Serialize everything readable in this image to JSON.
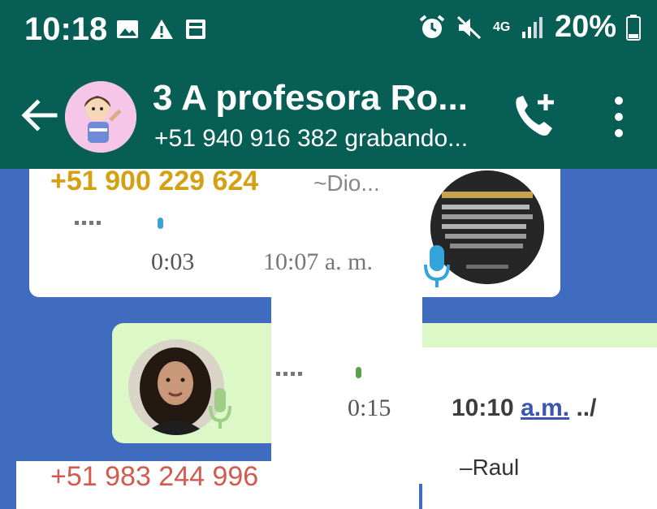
{
  "status_bar": {
    "time": "10:18",
    "network": "4G",
    "battery_percent": "20%"
  },
  "header": {
    "title": "3 A  profesora  Ro...",
    "subtitle": "+51 940 916 382 grabando..."
  },
  "messages": [
    {
      "sender": "+51 900 229 624",
      "alias": "~Dio...",
      "type": "voice",
      "duration": "0:03",
      "time": "10:07 a. m."
    },
    {
      "type": "voice",
      "duration": "0:15",
      "time_prefix": "10:10",
      "time_ampm": "a.m.",
      "time_suffix": "../",
      "sender_name": "–Raul"
    },
    {
      "sender": "+51 983 244 996"
    }
  ],
  "colors": {
    "header": "#075e54",
    "chat_background": "#3f6cbf",
    "outgoing_bubble": "#dcf8c6",
    "sender1": "#d4a014",
    "sender3": "#d25a50"
  }
}
